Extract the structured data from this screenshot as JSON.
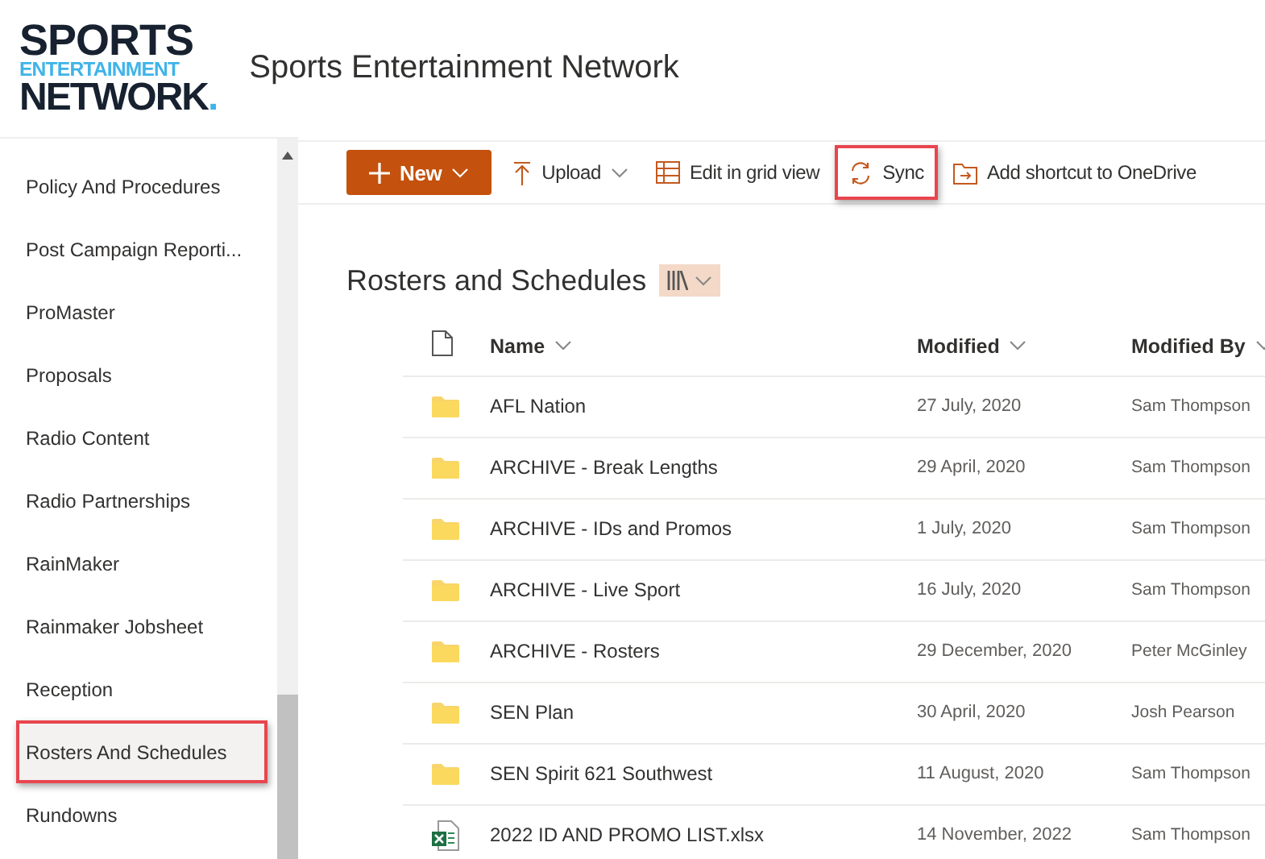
{
  "header": {
    "logo": {
      "line_1": "SPORTS",
      "line_2": "ENTERTAINMENT",
      "line_3": "NETWORK",
      "line_3_dot": "."
    },
    "title": "Sports Entertainment Network"
  },
  "sidebar": {
    "items": [
      {
        "label": "Policy And Procedures",
        "selected": false,
        "highlighted": false
      },
      {
        "label": "Post Campaign Reporti...",
        "selected": false,
        "highlighted": false
      },
      {
        "label": "ProMaster",
        "selected": false,
        "highlighted": false
      },
      {
        "label": "Proposals",
        "selected": false,
        "highlighted": false
      },
      {
        "label": "Radio Content",
        "selected": false,
        "highlighted": false
      },
      {
        "label": "Radio Partnerships",
        "selected": false,
        "highlighted": false
      },
      {
        "label": "RainMaker",
        "selected": false,
        "highlighted": false
      },
      {
        "label": "Rainmaker Jobsheet",
        "selected": false,
        "highlighted": false
      },
      {
        "label": "Reception",
        "selected": false,
        "highlighted": false
      },
      {
        "label": "Rosters And Schedules",
        "selected": true,
        "highlighted": true
      },
      {
        "label": "Rundowns",
        "selected": false,
        "highlighted": false
      }
    ]
  },
  "toolbar": {
    "items": [
      {
        "kind": "new",
        "label": "New",
        "dropdown": true,
        "highlighted": false
      },
      {
        "kind": "upload",
        "label": "Upload",
        "dropdown": true,
        "highlighted": false
      },
      {
        "kind": "grid",
        "label": "Edit in grid view",
        "dropdown": false,
        "highlighted": false
      },
      {
        "kind": "sync",
        "label": "Sync",
        "dropdown": false,
        "highlighted": true
      },
      {
        "kind": "shortcut",
        "label": "Add shortcut to OneDrive",
        "dropdown": false,
        "highlighted": false
      }
    ]
  },
  "library": {
    "title": "Rosters and Schedules",
    "columns": [
      {
        "label": "Name"
      },
      {
        "label": "Modified"
      },
      {
        "label": "Modified By"
      }
    ],
    "rows": [
      {
        "kind": "folder",
        "name": "AFL Nation",
        "modified": "27 July, 2020",
        "modified_by": "Sam Thompson"
      },
      {
        "kind": "folder",
        "name": "ARCHIVE - Break Lengths",
        "modified": "29 April, 2020",
        "modified_by": "Sam Thompson"
      },
      {
        "kind": "folder",
        "name": "ARCHIVE - IDs and Promos",
        "modified": "1 July, 2020",
        "modified_by": "Sam Thompson"
      },
      {
        "kind": "folder",
        "name": "ARCHIVE - Live Sport",
        "modified": "16 July, 2020",
        "modified_by": "Sam Thompson"
      },
      {
        "kind": "folder",
        "name": "ARCHIVE - Rosters",
        "modified": "29 December, 2020",
        "modified_by": "Peter McGinley"
      },
      {
        "kind": "folder",
        "name": "SEN Plan",
        "modified": "30 April, 2020",
        "modified_by": "Josh Pearson"
      },
      {
        "kind": "folder",
        "name": "SEN Spirit 621 Southwest",
        "modified": "11 August, 2020",
        "modified_by": "Sam Thompson"
      },
      {
        "kind": "excel",
        "name": "2022 ID AND PROMO LIST.xlsx",
        "modified": "14 November, 2022",
        "modified_by": "Sam Thompson"
      }
    ]
  }
}
